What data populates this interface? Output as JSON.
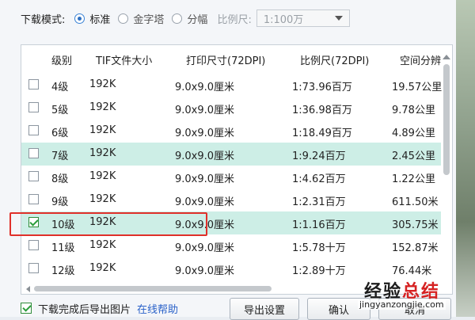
{
  "download_mode": {
    "label": "下载模式:",
    "options": [
      {
        "label": "标准",
        "selected": true
      },
      {
        "label": "金字塔",
        "selected": false
      },
      {
        "label": "分幅",
        "selected": false
      }
    ],
    "scale_label": "比例尺:",
    "scale_value": "1:100万"
  },
  "table": {
    "headers": [
      "级别",
      "TIF文件大小",
      "打印尺寸(72DPI)",
      "比例尺(72DPI)",
      "空间分辨"
    ],
    "rows": [
      {
        "checked": false,
        "level": "4级",
        "size": "192K",
        "print": "9.0x9.0厘米",
        "scale": "1:73.96百万",
        "res": "19.57公里"
      },
      {
        "checked": false,
        "level": "5级",
        "size": "192K",
        "print": "9.0x9.0厘米",
        "scale": "1:36.98百万",
        "res": "9.78公里"
      },
      {
        "checked": false,
        "level": "6级",
        "size": "192K",
        "print": "9.0x9.0厘米",
        "scale": "1:18.49百万",
        "res": "4.89公里"
      },
      {
        "checked": false,
        "level": "7级",
        "size": "192K",
        "print": "9.0x9.0厘米",
        "scale": "1:9.24百万",
        "res": "2.45公里",
        "highlight": true
      },
      {
        "checked": false,
        "level": "8级",
        "size": "192K",
        "print": "9.0x9.0厘米",
        "scale": "1:4.62百万",
        "res": "1.22公里"
      },
      {
        "checked": false,
        "level": "9级",
        "size": "192K",
        "print": "9.0x9.0厘米",
        "scale": "1:2.31百万",
        "res": "611.50米"
      },
      {
        "checked": true,
        "level": "10级",
        "size": "192K",
        "print": "9.0x9.0厘米",
        "scale": "1:1.16百万",
        "res": "305.75米",
        "highlight": true
      },
      {
        "checked": false,
        "level": "11级",
        "size": "192K",
        "print": "9.0x9.0厘米",
        "scale": "1:5.78十万",
        "res": "152.87米"
      },
      {
        "checked": false,
        "level": "12级",
        "size": "192K",
        "print": "9.0x9.0厘米",
        "scale": "1:2.89十万",
        "res": "76.44米"
      }
    ]
  },
  "footer": {
    "export_checkbox_label": "下载完成后导出图片",
    "help_link": "在线帮助",
    "export_settings_button": "导出设置",
    "ok_button": "确认",
    "cancel_button": "取消"
  },
  "watermark": {
    "line1_a": "经验",
    "line1_b": "总结",
    "line2": "jingyanzongjie.com"
  },
  "colors": {
    "highlight_row": "#cdeee6",
    "annotation_red": "#e0302a",
    "link": "#2b62c9"
  }
}
